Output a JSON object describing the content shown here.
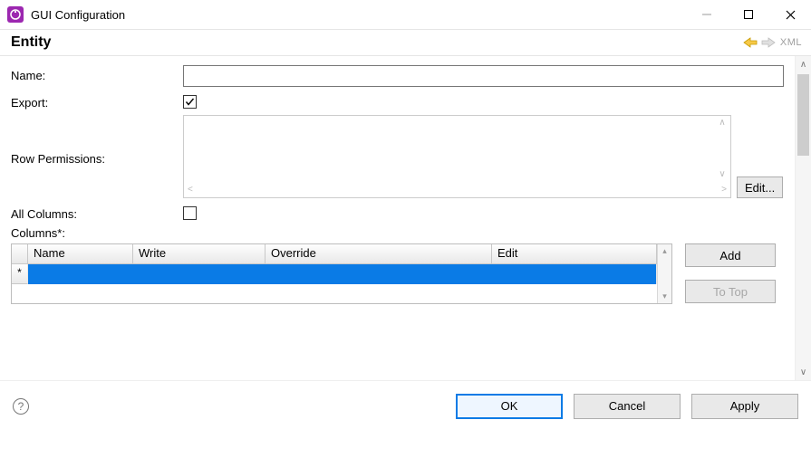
{
  "window": {
    "title": "GUI Configuration"
  },
  "header": {
    "title": "Entity",
    "xml_label": "XML"
  },
  "form": {
    "name_label": "Name:",
    "name_value": "",
    "export_label": "Export:",
    "export_checked": true,
    "rowperm_label": "Row Permissions:",
    "rowperm_value": "",
    "edit_button": "Edit...",
    "allcols_label": "All Columns:",
    "allcols_checked": false,
    "columns_label": "Columns*:"
  },
  "grid": {
    "headers": {
      "name": "Name",
      "write": "Write",
      "override": "Override",
      "edit": "Edit"
    },
    "new_row_marker": "*",
    "rows": []
  },
  "side_buttons": {
    "add": "Add",
    "to_top": "To Top"
  },
  "footer": {
    "ok": "OK",
    "cancel": "Cancel",
    "apply": "Apply"
  }
}
